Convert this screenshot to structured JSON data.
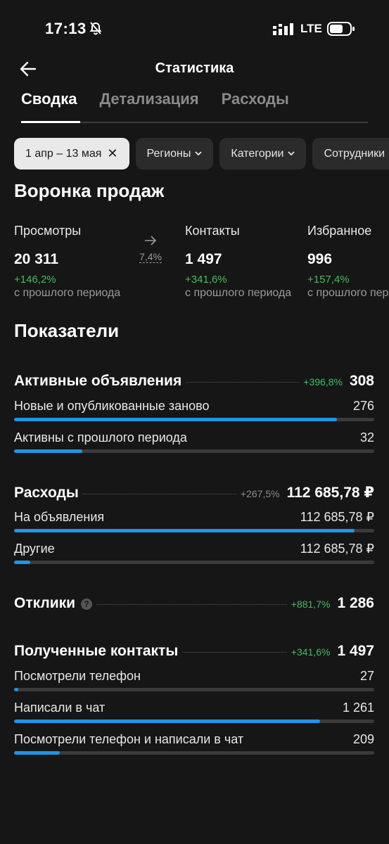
{
  "status": {
    "time": "17:13",
    "network": "LTE"
  },
  "header": {
    "title": "Статистика"
  },
  "tabs": [
    {
      "label": "Сводка",
      "active": true
    },
    {
      "label": "Детализация",
      "active": false
    },
    {
      "label": "Расходы",
      "active": false
    }
  ],
  "filters": {
    "date": "1 апр – 13 мая",
    "regions": "Регионы",
    "categories": "Категории",
    "staff": "Сотрудники"
  },
  "funnel": {
    "title": "Воронка продаж",
    "conversion": "7,4%",
    "items": [
      {
        "label": "Просмотры",
        "value": "20 311",
        "delta": "+146,2%",
        "sub": "с прошлого периода"
      },
      {
        "label": "Контакты",
        "value": "1 497",
        "delta": "+341,6%",
        "sub": "с прошлого периода"
      },
      {
        "label": "Избранное",
        "value": "996",
        "delta": "+157,4%",
        "sub": "с прошлого периода"
      }
    ]
  },
  "metrics": {
    "title": "Показатели",
    "ads": {
      "title": "Активные объявления",
      "delta": "+396,8%",
      "value": "308",
      "rows": [
        {
          "label": "Новые и опубликованные заново",
          "value": "276",
          "fill": 0.896
        },
        {
          "label": "Активны с прошлого периода",
          "value": "32",
          "fill": 0.19
        }
      ]
    },
    "expenses": {
      "title": "Расходы",
      "delta": "+267,5%",
      "value": "112 685,78 ₽",
      "rows": [
        {
          "label": "На объявления",
          "value": "112 685,78 ₽",
          "fill": 0.945
        },
        {
          "label": "Другие",
          "value": "112 685,78 ₽",
          "fill": 0.045
        }
      ]
    },
    "responses": {
      "title": "Отклики",
      "delta": "+881,7%",
      "value": "1 286"
    },
    "contacts": {
      "title": "Полученные контакты",
      "delta": "+341,6%",
      "value": "1 497",
      "rows": [
        {
          "label": "Посмотрели телефон",
          "value": "27",
          "fill": 0.012
        },
        {
          "label": "Написали в чат",
          "value": "1 261",
          "fill": 0.85
        },
        {
          "label": "Посмотрели телефон и написали в чат",
          "value": "209",
          "fill": 0.127
        }
      ]
    }
  },
  "colors": {
    "accent": "#1e95e8",
    "positive": "#3fbf5f",
    "background": "#161616"
  }
}
